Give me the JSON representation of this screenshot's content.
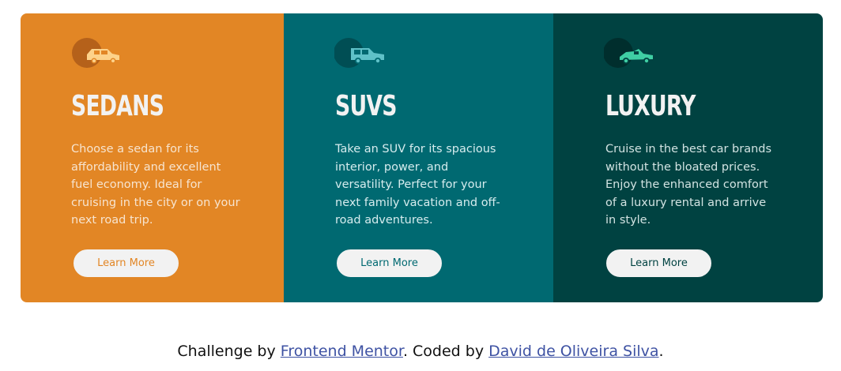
{
  "cards": [
    {
      "title": "SEDANS",
      "description": "Choose a sedan for its affordability and excellent fuel economy. Ideal for cruising in the city or on your next road trip.",
      "button_label": "Learn More",
      "icon": "sedan-car-icon",
      "background": "#e28625",
      "text_color": "#f2f2f2",
      "button_text_color": "#e28625"
    },
    {
      "title": "SUVS",
      "description": "Take an SUV for its spacious interior, power, and versatility. Perfect for your next family vacation and off-road adventures.",
      "button_label": "Learn More",
      "icon": "suv-car-icon",
      "background": "#006971",
      "text_color": "#f2f2f2",
      "button_text_color": "#006971"
    },
    {
      "title": "LUXURY",
      "description": "Cruise in the best car brands without the bloated prices. Enjoy the enhanced comfort of a luxury rental and arrive in style.",
      "button_label": "Learn More",
      "icon": "luxury-car-icon",
      "background": "#004241",
      "text_color": "#f2f2f2",
      "button_text_color": "#004241"
    }
  ],
  "attribution": {
    "prefix": "Challenge by ",
    "link1": "Frontend Mentor",
    "middle": ". Coded by ",
    "link2": "David de Oliveira Silva",
    "suffix": "."
  }
}
